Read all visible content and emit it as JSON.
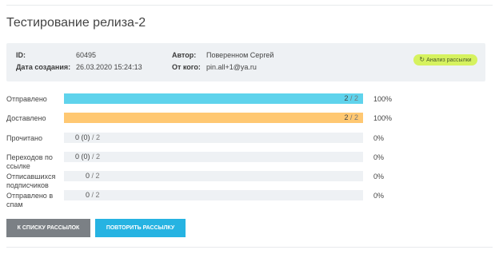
{
  "title": "Тестирование релиза-2",
  "info": {
    "id_label": "ID:",
    "id_value": "60495",
    "created_label": "Дата создания:",
    "created_value": "26.03.2020 15:24:13",
    "author_label": "Автор:",
    "author_value": "Поверенном Сергей",
    "from_label": "От кого:",
    "from_value": "pin.all+1@ya.ru",
    "analysis_button": "Анализ рассылки"
  },
  "stats": [
    {
      "label": "Отправлено",
      "count": "2",
      "total": "/ 2",
      "percent": "100%",
      "fraction": 1.0,
      "color": "#5fd3ec"
    },
    {
      "label": "Доставлено",
      "count": "2",
      "total": "/ 2",
      "percent": "100%",
      "fraction": 1.0,
      "color": "#ffc872"
    },
    {
      "label": "Прочитано",
      "count": "0 (0)",
      "total": "/ 2",
      "percent": "0%",
      "fraction": 0
    },
    {
      "label_line1": "Переходов по",
      "label_line2": "ссылке",
      "count": "0 (0)",
      "total": "/ 2",
      "percent": "0%",
      "fraction": 0
    },
    {
      "label_line1": "Отписавшихся",
      "label_line2": "подписчиков",
      "count": "0",
      "total": "/ 2",
      "percent": "0%",
      "fraction": 0
    },
    {
      "label_line1": "Отправлено в",
      "label_line2": "спам",
      "count": "0",
      "total": "/ 2",
      "percent": "0%",
      "fraction": 0
    }
  ],
  "buttons": {
    "back_to_list": "К СПИСКУ РАССЫЛОК",
    "repeat": "ПОВТОРИТЬ РАССЫЛКУ"
  },
  "colors": {
    "accent_blue": "#26b3e2",
    "bar_blue": "#5fd3ec",
    "bar_orange": "#ffc872",
    "analysis_green": "#d6f25f",
    "button_grey": "#7b8085"
  }
}
